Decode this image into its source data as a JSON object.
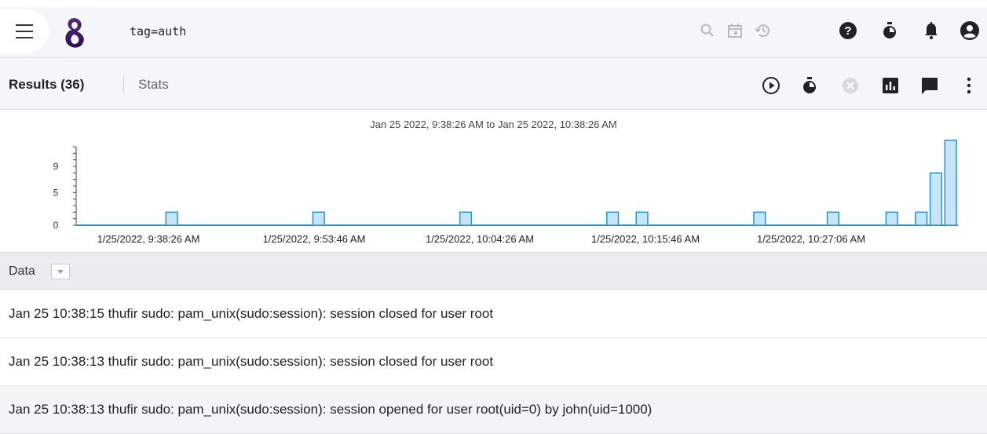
{
  "topbar": {
    "query": "tag=auth",
    "icons": [
      "menu-icon",
      "logo",
      "search-icon",
      "calendar-icon",
      "history-icon",
      "help-icon",
      "timer-icon",
      "bell-icon",
      "account-icon"
    ]
  },
  "results": {
    "title": "Results (36)",
    "stats_tab": "Stats",
    "icons": [
      "play-icon",
      "timer-icon",
      "cancel-icon",
      "chart-icon",
      "comment-icon",
      "more-vert-icon"
    ]
  },
  "chart_data": {
    "type": "bar",
    "title": "Jan 25 2022, 9:38:26 AM to Jan 25 2022, 10:38:26 AM",
    "xlabel": "",
    "ylabel": "",
    "ylim": [
      0,
      12
    ],
    "yticks": [
      0,
      5,
      9
    ],
    "xticks": [
      "1/25/2022, 9:38:26 AM",
      "1/25/2022, 9:53:46 AM",
      "1/25/2022, 10:04:26 AM",
      "1/25/2022, 10:15:46 AM",
      "1/25/2022, 10:27:06 AM"
    ],
    "bucket_count": 60,
    "buckets": [
      {
        "index": 6,
        "value": 2
      },
      {
        "index": 16,
        "value": 2
      },
      {
        "index": 26,
        "value": 2
      },
      {
        "index": 36,
        "value": 2
      },
      {
        "index": 38,
        "value": 2
      },
      {
        "index": 46,
        "value": 2
      },
      {
        "index": 51,
        "value": 2
      },
      {
        "index": 55,
        "value": 2
      },
      {
        "index": 57,
        "value": 2
      },
      {
        "index": 58,
        "value": 8
      },
      {
        "index": 59,
        "value": 13
      }
    ],
    "grid": false,
    "legend": "none"
  },
  "data": {
    "column_label": "Data",
    "rows": [
      "Jan 25 10:38:15 thufir sudo: pam_unix(sudo:session): session closed for user root",
      "Jan 25 10:38:13 thufir sudo: pam_unix(sudo:session): session closed for user root",
      "Jan 25 10:38:13 thufir sudo: pam_unix(sudo:session): session opened for user root(uid=0) by john(uid=1000)"
    ]
  },
  "colors": {
    "bar_fill": "#c6e5f7",
    "bar_stroke": "#2a93d5",
    "baseline": "#2a93d5"
  }
}
